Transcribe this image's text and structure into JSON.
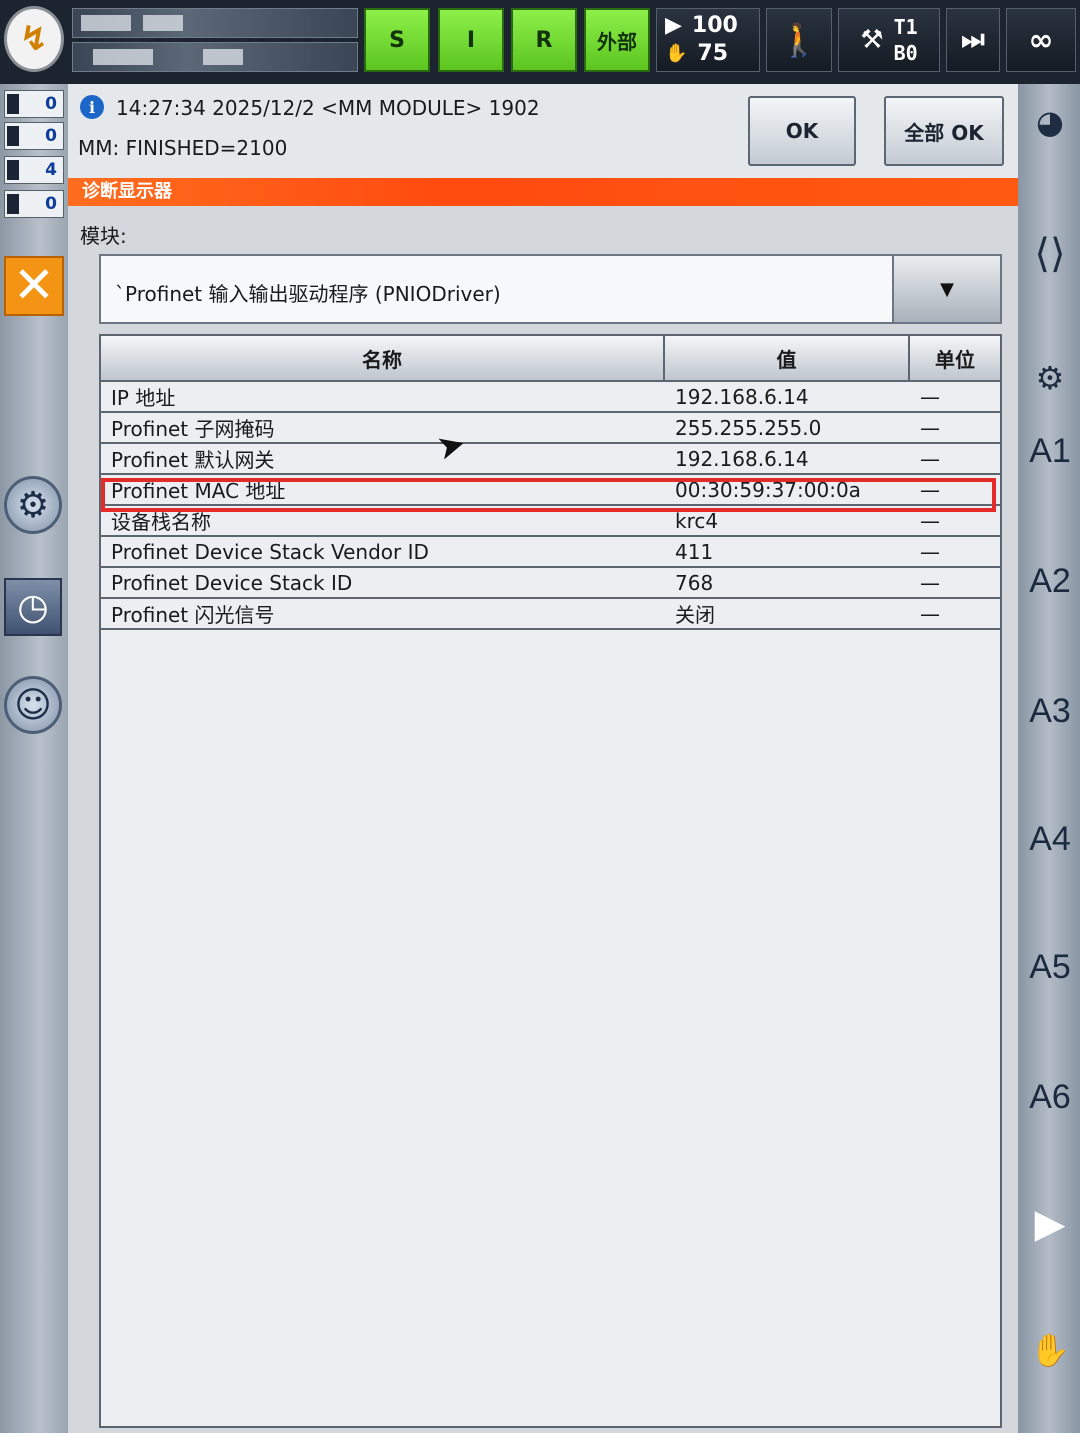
{
  "topbar": {
    "s_label": "S",
    "i_label": "I",
    "r_label": "R",
    "external_label": "外部",
    "program_override": "100",
    "manual_override": "75",
    "mode": "T1",
    "base": "B0",
    "infinity": "∞"
  },
  "left_counters": [
    "0",
    "0",
    "4",
    "0"
  ],
  "message": {
    "line1": "14:27:34 2025/12/2 <MM MODULE> 1902",
    "line2": "MM: FINISHED=2100",
    "ok_label": "OK",
    "all_ok_label": "全部 OK"
  },
  "window_title": "诊断显示器",
  "module": {
    "label": "模块:",
    "selected": "`Profinet 输入输出驱动程序 (PNIODriver)"
  },
  "table": {
    "headers": [
      "名称",
      "值",
      "单位"
    ],
    "rows": [
      {
        "name": "IP 地址",
        "value": "192.168.6.14",
        "unit": "—"
      },
      {
        "name": "Profinet 子网掩码",
        "value": "255.255.255.0",
        "unit": "—"
      },
      {
        "name": "Profinet 默认网关",
        "value": "192.168.6.14",
        "unit": "—"
      },
      {
        "name": "Profinet MAC 地址",
        "value": "00:30:59:37:00:0a",
        "unit": "—"
      },
      {
        "name": "设备栈名称",
        "value": "krc4",
        "unit": "—"
      },
      {
        "name": "Profinet Device Stack Vendor ID",
        "value": "411",
        "unit": "—"
      },
      {
        "name": "Profinet Device Stack ID",
        "value": "768",
        "unit": "—"
      },
      {
        "name": "Profinet 闪光信号",
        "value": "关闭",
        "unit": "—"
      }
    ]
  },
  "axes": [
    "A1",
    "A2",
    "A3",
    "A4",
    "A5",
    "A6"
  ]
}
